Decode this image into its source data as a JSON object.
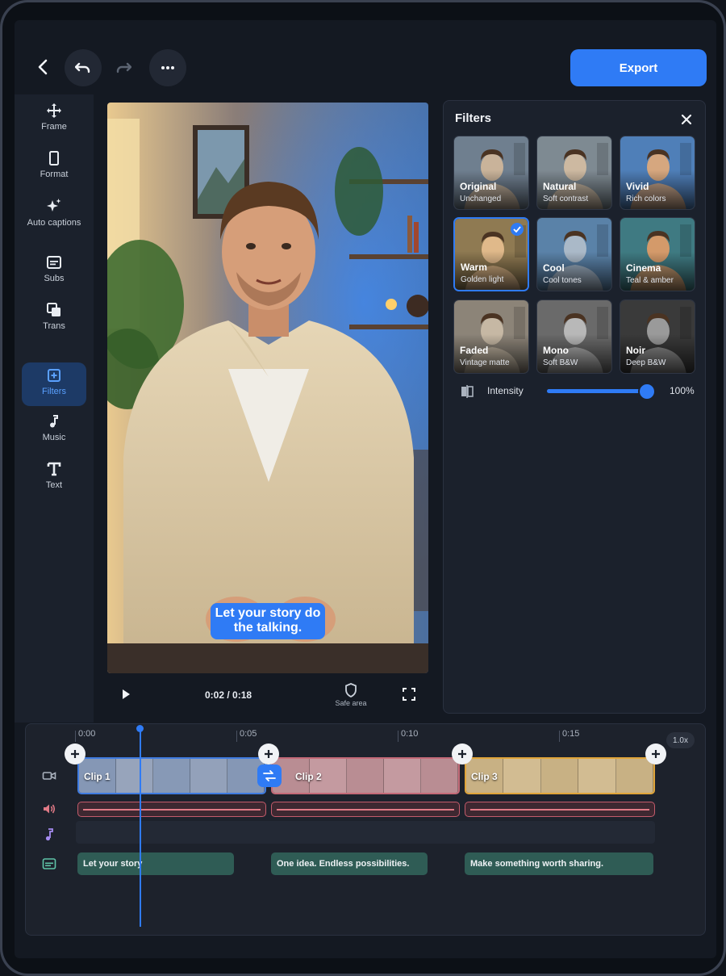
{
  "toolbar": {
    "back_icon": "chevron-left-icon",
    "undo_icon": "undo-icon",
    "redo_icon": "redo-icon",
    "more_icon": "more-horizontal-icon",
    "export_label": "Export"
  },
  "sidebar": {
    "items": [
      {
        "label": "Frame",
        "icon": "move-arrows-icon"
      },
      {
        "label": "Format",
        "icon": "portrait-frame-icon"
      },
      {
        "label": "Auto captions",
        "icon": "sparkle-icon"
      },
      {
        "label": "Subs",
        "icon": "subtitles-icon"
      },
      {
        "label": "Trans",
        "icon": "transition-stack-icon"
      },
      {
        "label": "Filters",
        "icon": "filter-add-icon",
        "active": true
      },
      {
        "label": "Music",
        "icon": "music-note-icon"
      },
      {
        "label": "Text",
        "icon": "text-t-icon"
      }
    ]
  },
  "preview": {
    "caption": "Let your story do the talking.",
    "time": "0:02 / 0:18",
    "safe_area_label": "Safe area"
  },
  "filters": {
    "title": "Filters",
    "items": [
      {
        "name": "Original",
        "subtitle": "Unchanged",
        "selected": false
      },
      {
        "name": "Natural",
        "subtitle": "Soft contrast",
        "selected": false
      },
      {
        "name": "Vivid",
        "subtitle": "Rich colors",
        "selected": false
      },
      {
        "name": "Warm",
        "subtitle": "Golden light",
        "selected": true
      },
      {
        "name": "Cool",
        "subtitle": "Cool tones",
        "selected": false
      },
      {
        "name": "Cinema",
        "subtitle": "Teal & amber",
        "selected": false
      },
      {
        "name": "Faded",
        "subtitle": "Vintage matte",
        "selected": false
      },
      {
        "name": "Mono",
        "subtitle": "Soft B&W",
        "selected": false
      },
      {
        "name": "Noir",
        "subtitle": "Deep B&W",
        "selected": false
      }
    ],
    "intensity_label": "Intensity",
    "intensity_value": "100%",
    "intensity_fraction": 1.0
  },
  "timeline": {
    "ticks": [
      "0:00",
      "0:05",
      "0:10",
      "0:15"
    ],
    "speed": "1.0x",
    "clips": [
      {
        "label": "Clip 1",
        "color": "#3f7be0"
      },
      {
        "label": "Clip 2",
        "color": "#c46a78"
      },
      {
        "label": "Clip 3",
        "color": "#e0a53a"
      }
    ],
    "subtitles": [
      "Let your story",
      "One idea. Endless possibilities.",
      "Make something worth sharing."
    ],
    "track_icons": [
      "video-camera-icon",
      "speaker-icon",
      "music-note-icon",
      "subtitles-icon"
    ]
  },
  "colors": {
    "accent": "#2f7bf5",
    "panel": "#1b212c",
    "subtitle_track": "#2f5c55",
    "audio_track": "#c45b6b"
  }
}
